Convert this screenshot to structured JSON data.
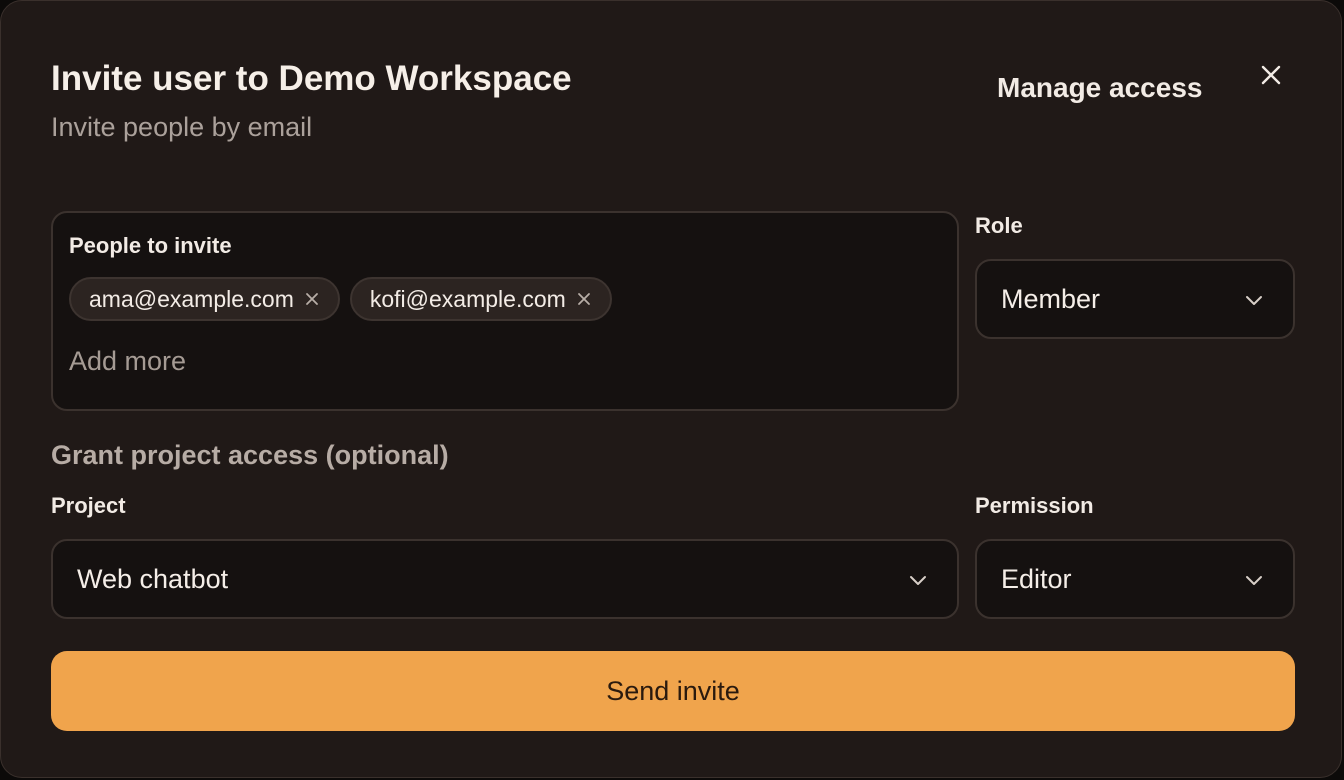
{
  "dialog": {
    "title": "Invite user to Demo Workspace",
    "subtitle": "Invite people by email",
    "manage_access_label": "Manage access",
    "close_icon": "close-icon"
  },
  "invite": {
    "people_label": "People to invite",
    "chips": [
      {
        "email": "ama@example.com",
        "remove_icon": "close-icon"
      },
      {
        "email": "kofi@example.com",
        "remove_icon": "close-icon"
      }
    ],
    "add_more_placeholder": "Add more"
  },
  "role": {
    "label": "Role",
    "value": "Member",
    "icon": "chevron-down-icon"
  },
  "project_access": {
    "section_title": "Grant project access (optional)",
    "project_label": "Project",
    "project_value": "Web chatbot",
    "permission_label": "Permission",
    "permission_value": "Editor"
  },
  "actions": {
    "send_label": "Send invite"
  },
  "colors": {
    "dialog_bg": "#201917",
    "field_bg": "#151110",
    "accent": "#f0a44c"
  }
}
